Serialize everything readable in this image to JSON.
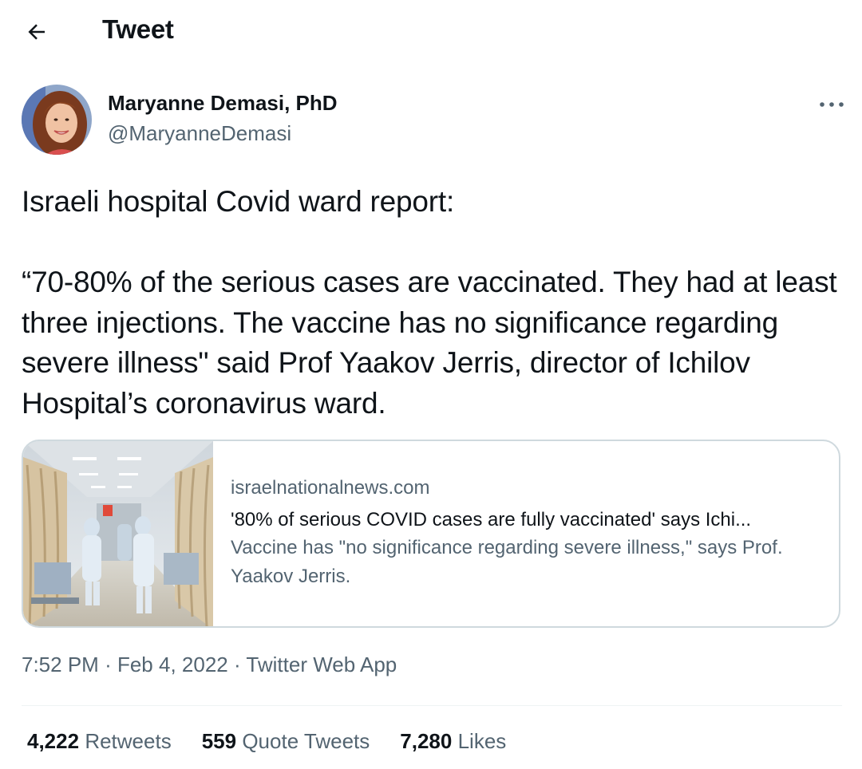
{
  "header": {
    "title": "Tweet",
    "back_icon": "arrow-left-icon"
  },
  "author": {
    "name": "Maryanne Demasi, PhD",
    "handle": "@MaryanneDemasi",
    "avatar_icon": "avatar"
  },
  "more_icon": "more-horizontal-icon",
  "tweet": {
    "text": "Israeli hospital Covid ward report:\n\n“70-80% of the serious cases are vaccinated. They had at least three injections. The vaccine has no significance regarding severe illness\" said Prof Yaakov Jerris, director of Ichilov Hospital’s coronavirus ward."
  },
  "link_card": {
    "domain": "israelnationalnews.com",
    "title": "'80% of serious COVID cases are fully vaccinated' says Ichi...",
    "description": "Vaccine has \"no significance regarding severe illness,\" says Prof. Yaakov Jerris."
  },
  "meta": {
    "time": "7:52 PM",
    "separator": "·",
    "date": "Feb 4, 2022",
    "source": "Twitter Web App"
  },
  "stats": [
    {
      "count": "4,222",
      "label": "Retweets"
    },
    {
      "count": "559",
      "label": "Quote Tweets"
    },
    {
      "count": "7,280",
      "label": "Likes"
    }
  ],
  "colors": {
    "text": "#0f1419",
    "secondary": "#536471",
    "border": "#cfd9de",
    "divider": "#eff3f4"
  }
}
